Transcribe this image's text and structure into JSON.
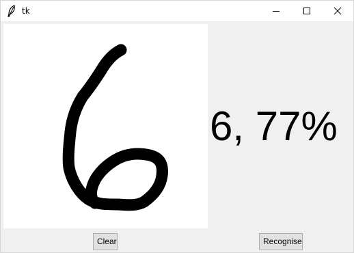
{
  "window": {
    "title": "tk"
  },
  "result": {
    "digit": "6",
    "confidence_percent": 77,
    "text": "6, 77%"
  },
  "buttons": {
    "clear_label": "Clear",
    "recognise_label": "Recognise"
  },
  "icons": {
    "app": "feather-icon",
    "minimize": "minimize-icon",
    "maximize": "maximize-icon",
    "close": "close-icon"
  },
  "colors": {
    "window_bg": "#f0f0f0",
    "canvas_bg": "#ffffff",
    "stroke": "#000000"
  }
}
